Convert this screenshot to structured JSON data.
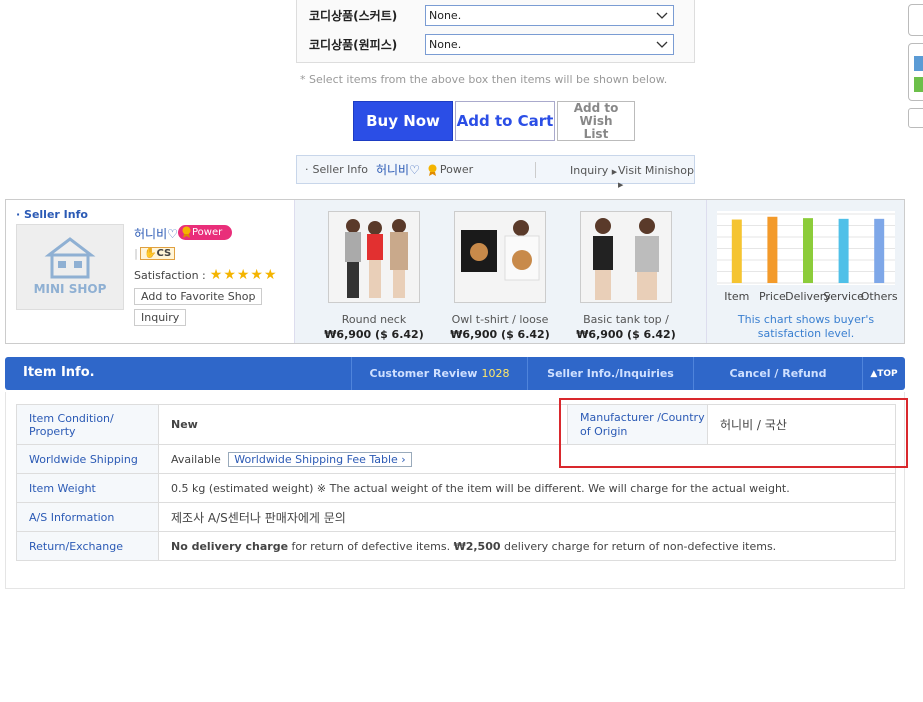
{
  "options": {
    "rows": [
      {
        "label": "코디상품(스커트)",
        "value": "None."
      },
      {
        "label": "코디상품(원피스)",
        "value": "None."
      }
    ],
    "note": "* Select items from the above box then items will be shown below."
  },
  "actions": {
    "buy_now": "Buy Now",
    "add_to_cart": "Add to Cart",
    "wish_list": "Add to Wish List"
  },
  "seller_bar": {
    "label": "Seller Info",
    "name": "허니비♡",
    "power": "Power",
    "inquiry": "Inquiry",
    "visit": "Visit Minishop"
  },
  "seller_info": {
    "title": "Seller Info",
    "minishop": "MINI SHOP",
    "name": "허니비♡",
    "badge": "Power",
    "cs": "CS",
    "satisfaction_label": "Satisfaction :",
    "stars": 5,
    "favorite_button": "Add to Favorite Shop",
    "inquiry_button": "Inquiry"
  },
  "products": [
    {
      "name": "Round neck",
      "price": "₩6,900 ($ 6.42)"
    },
    {
      "name": "Owl t-shirt / loose",
      "price": "₩6,900 ($ 6.42)"
    },
    {
      "name": "Basic tank top /",
      "price": "₩6,900 ($ 6.42)"
    }
  ],
  "chart_data": {
    "type": "bar",
    "categories": [
      "Item",
      "Price",
      "Delivery",
      "Service",
      "Others"
    ],
    "values": [
      92,
      96,
      94,
      93,
      93
    ],
    "colors": [
      "#f5c431",
      "#f39a2a",
      "#8ccc3a",
      "#4fc0e8",
      "#7ea7e8"
    ],
    "ylim": [
      0,
      100
    ],
    "caption": "This chart shows buyer's satisfaction level."
  },
  "tabs": {
    "item_info": "Item Info.",
    "customer_review": "Customer Review",
    "review_count": "1028",
    "seller_inquiries": "Seller Info./Inquiries",
    "cancel_refund": "Cancel / Refund",
    "top": "▲TOP"
  },
  "item_info": {
    "condition_label": "Item Condition/ Property",
    "condition_value": "New",
    "manufacturer_label": "Manufacturer /Country of Origin",
    "manufacturer_value": "허니비 / 국산",
    "shipping_label": "Worldwide Shipping",
    "shipping_value": "Available",
    "shipping_button": "Worldwide Shipping Fee Table ›",
    "weight_label": "Item Weight",
    "weight_value": "0.5 kg (estimated weight) ※ The actual weight of the item will be different. We will charge for the actual weight.",
    "as_label": "A/S Information",
    "as_value": "제조사 A/S센터나 판매자에게 문의",
    "return_label": "Return/Exchange",
    "return_bold1": "No delivery charge",
    "return_text1": " for return of defective items. ",
    "return_bold2": "₩2,500",
    "return_text2": " delivery charge for return of non-defective items."
  }
}
